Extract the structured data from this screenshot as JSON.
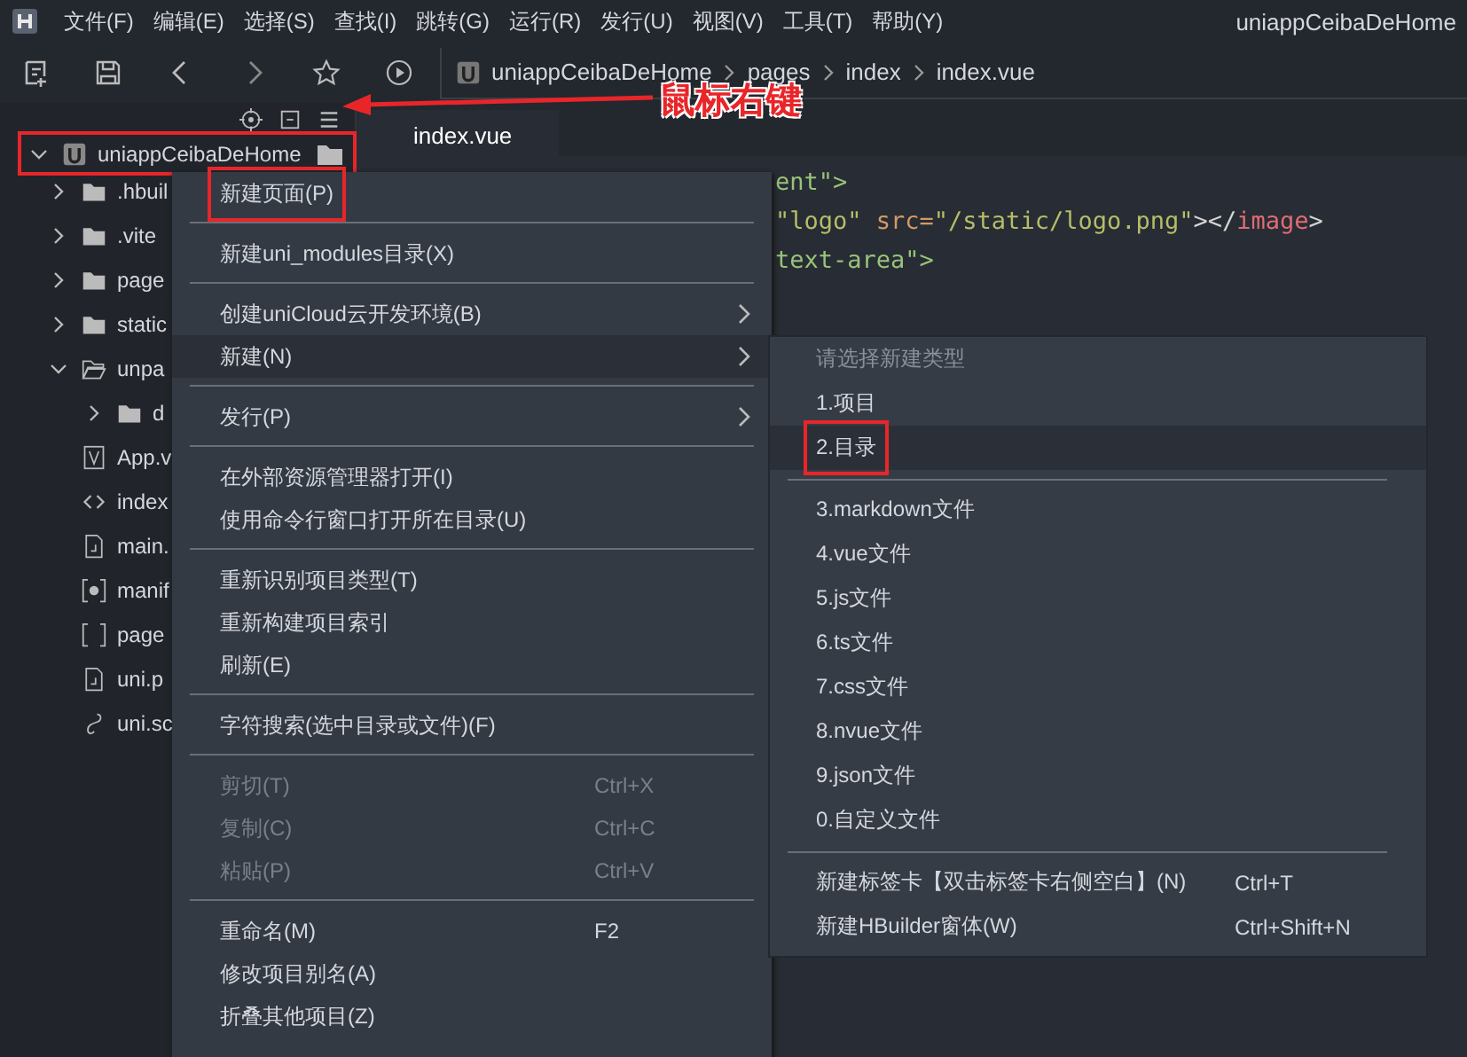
{
  "menu_bar": {
    "items": [
      "文件(F)",
      "编辑(E)",
      "选择(S)",
      "查找(I)",
      "跳转(G)",
      "运行(R)",
      "发行(U)",
      "视图(V)",
      "工具(T)",
      "帮助(Y)"
    ],
    "title": "uniappCeibaDeHome"
  },
  "breadcrumb": [
    "uniappCeibaDeHome",
    "pages",
    "index",
    "index.vue"
  ],
  "annotation": {
    "text": "鼠标右键"
  },
  "tab": {
    "label": "index.vue",
    "selected": true
  },
  "project_tree": {
    "root": {
      "label": "uniappCeibaDeHome",
      "expanded": true,
      "annotated": true
    },
    "items": [
      {
        "kind": "folder",
        "label": ".hbuil",
        "expanded": false
      },
      {
        "kind": "folder",
        "label": ".vite",
        "expanded": false
      },
      {
        "kind": "folder",
        "label": "page",
        "expanded": false
      },
      {
        "kind": "folder",
        "label": "static",
        "expanded": false
      },
      {
        "kind": "folder",
        "label": "unpa",
        "expanded": true,
        "children": [
          {
            "kind": "folder",
            "label": "d",
            "expanded": false
          }
        ]
      },
      {
        "kind": "vue",
        "label": "App.v"
      },
      {
        "kind": "html",
        "label": "index"
      },
      {
        "kind": "js",
        "label": "main."
      },
      {
        "kind": "gear",
        "label": "manif"
      },
      {
        "kind": "json",
        "label": "page"
      },
      {
        "kind": "js",
        "label": "uni.p"
      },
      {
        "kind": "style",
        "label": "uni.sc"
      }
    ]
  },
  "code_lines": [
    [
      {
        "text": "ent\">",
        "color": "#98c379"
      }
    ],
    [
      {
        "text": "\"logo\" ",
        "color": "#b5bd68"
      },
      {
        "text": "src=",
        "color": "#d19a66"
      },
      {
        "text": "\"/static/logo.png\"",
        "color": "#b5bd68"
      },
      {
        "text": "></",
        "color": "#d4d4d4"
      },
      {
        "text": "image",
        "color": "#e06c75"
      },
      {
        "text": ">",
        "color": "#d4d4d4"
      }
    ],
    [
      {
        "text": "text-area\">",
        "color": "#98c379"
      }
    ]
  ],
  "context_menu": [
    {
      "kind": "item",
      "label": "新建页面(P)",
      "annotated": true,
      "disabled": false,
      "submenu": false,
      "selected": false
    },
    {
      "kind": "separator"
    },
    {
      "kind": "item",
      "label": "新建uni_modules目录(X)",
      "disabled": false,
      "submenu": false,
      "selected": false
    },
    {
      "kind": "separator"
    },
    {
      "kind": "item",
      "label": "创建uniCloud云开发环境(B)",
      "disabled": false,
      "submenu": true,
      "selected": false
    },
    {
      "kind": "item",
      "label": "新建(N)",
      "disabled": false,
      "submenu": true,
      "selected": true
    },
    {
      "kind": "separator"
    },
    {
      "kind": "item",
      "label": "发行(P)",
      "disabled": false,
      "submenu": true,
      "selected": false
    },
    {
      "kind": "separator"
    },
    {
      "kind": "item",
      "label": "在外部资源管理器打开(I)",
      "disabled": false,
      "submenu": false,
      "selected": false
    },
    {
      "kind": "item",
      "label": "使用命令行窗口打开所在目录(U)",
      "disabled": false,
      "submenu": false,
      "selected": false
    },
    {
      "kind": "separator"
    },
    {
      "kind": "item",
      "label": "重新识别项目类型(T)",
      "disabled": false,
      "submenu": false,
      "selected": false
    },
    {
      "kind": "item",
      "label": "重新构建项目索引",
      "disabled": false,
      "submenu": false,
      "selected": false
    },
    {
      "kind": "item",
      "label": "刷新(E)",
      "disabled": false,
      "submenu": false,
      "selected": false
    },
    {
      "kind": "separator"
    },
    {
      "kind": "item",
      "label": "字符搜索(选中目录或文件)(F)",
      "disabled": false,
      "submenu": false,
      "selected": false
    },
    {
      "kind": "separator"
    },
    {
      "kind": "item",
      "label": "剪切(T)",
      "shortcut": "Ctrl+X",
      "disabled": true,
      "submenu": false,
      "selected": false
    },
    {
      "kind": "item",
      "label": "复制(C)",
      "shortcut": "Ctrl+C",
      "disabled": true,
      "submenu": false,
      "selected": false
    },
    {
      "kind": "item",
      "label": "粘贴(P)",
      "shortcut": "Ctrl+V",
      "disabled": true,
      "submenu": false,
      "selected": false
    },
    {
      "kind": "separator"
    },
    {
      "kind": "item",
      "label": "重命名(M)",
      "shortcut": "F2",
      "disabled": false,
      "submenu": false,
      "selected": false
    },
    {
      "kind": "item",
      "label": "修改项目别名(A)",
      "disabled": false,
      "submenu": false,
      "selected": false
    },
    {
      "kind": "item",
      "label": "折叠其他项目(Z)",
      "disabled": false,
      "submenu": false,
      "selected": false
    }
  ],
  "submenu": [
    {
      "kind": "header",
      "label": "请选择新建类型"
    },
    {
      "kind": "item",
      "label": "1.项目",
      "selected": false
    },
    {
      "kind": "item",
      "label": "2.目录",
      "selected": true,
      "annotated": true
    },
    {
      "kind": "separator"
    },
    {
      "kind": "item",
      "label": "3.markdown文件",
      "selected": false
    },
    {
      "kind": "item",
      "label": "4.vue文件",
      "selected": false
    },
    {
      "kind": "item",
      "label": "5.js文件",
      "selected": false
    },
    {
      "kind": "item",
      "label": "6.ts文件",
      "selected": false
    },
    {
      "kind": "item",
      "label": "7.css文件",
      "selected": false
    },
    {
      "kind": "item",
      "label": "8.nvue文件",
      "selected": false
    },
    {
      "kind": "item",
      "label": "9.json文件",
      "selected": false
    },
    {
      "kind": "item",
      "label": "0.自定义文件",
      "selected": false
    },
    {
      "kind": "separator"
    },
    {
      "kind": "item",
      "label": "新建标签卡【双击标签卡右侧空白】(N)",
      "shortcut": "Ctrl+T",
      "selected": false
    },
    {
      "kind": "item",
      "label": "新建HBuilder窗体(W)",
      "shortcut": "Ctrl+Shift+N",
      "selected": false
    }
  ]
}
